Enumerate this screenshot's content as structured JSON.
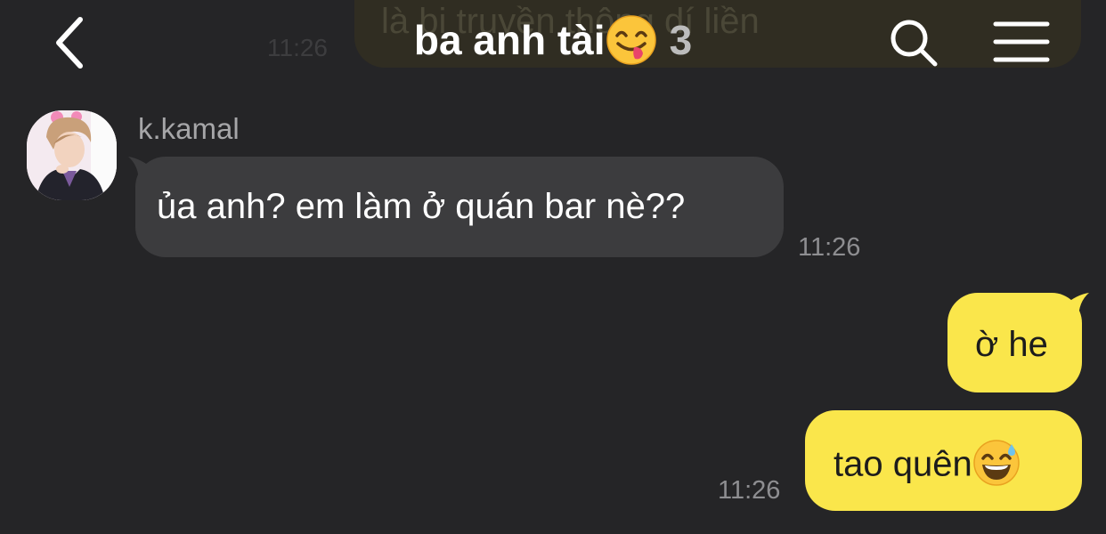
{
  "header": {
    "title": "ba anh tài",
    "title_emoji": "yum-face-emoji",
    "member_count": "3",
    "back_icon": "chevron-left-icon",
    "search_icon": "search-icon",
    "menu_icon": "hamburger-menu-icon"
  },
  "previous_message": {
    "text": "là bị truyền thông dí liền",
    "time": "11:26"
  },
  "messages": [
    {
      "direction": "incoming",
      "sender": "k.kamal",
      "text": "ủa anh? em làm ở quán bar nè??",
      "time": "11:26"
    },
    {
      "direction": "outgoing",
      "text": "ờ he"
    },
    {
      "direction": "outgoing",
      "text": "tao quên",
      "emoji": "grinning-sweat-emoji",
      "time": "11:26"
    }
  ],
  "colors": {
    "background": "#252527",
    "incoming_bubble": "#3c3c3e",
    "outgoing_bubble": "#fae64b",
    "timestamp": "#8e8e91"
  }
}
